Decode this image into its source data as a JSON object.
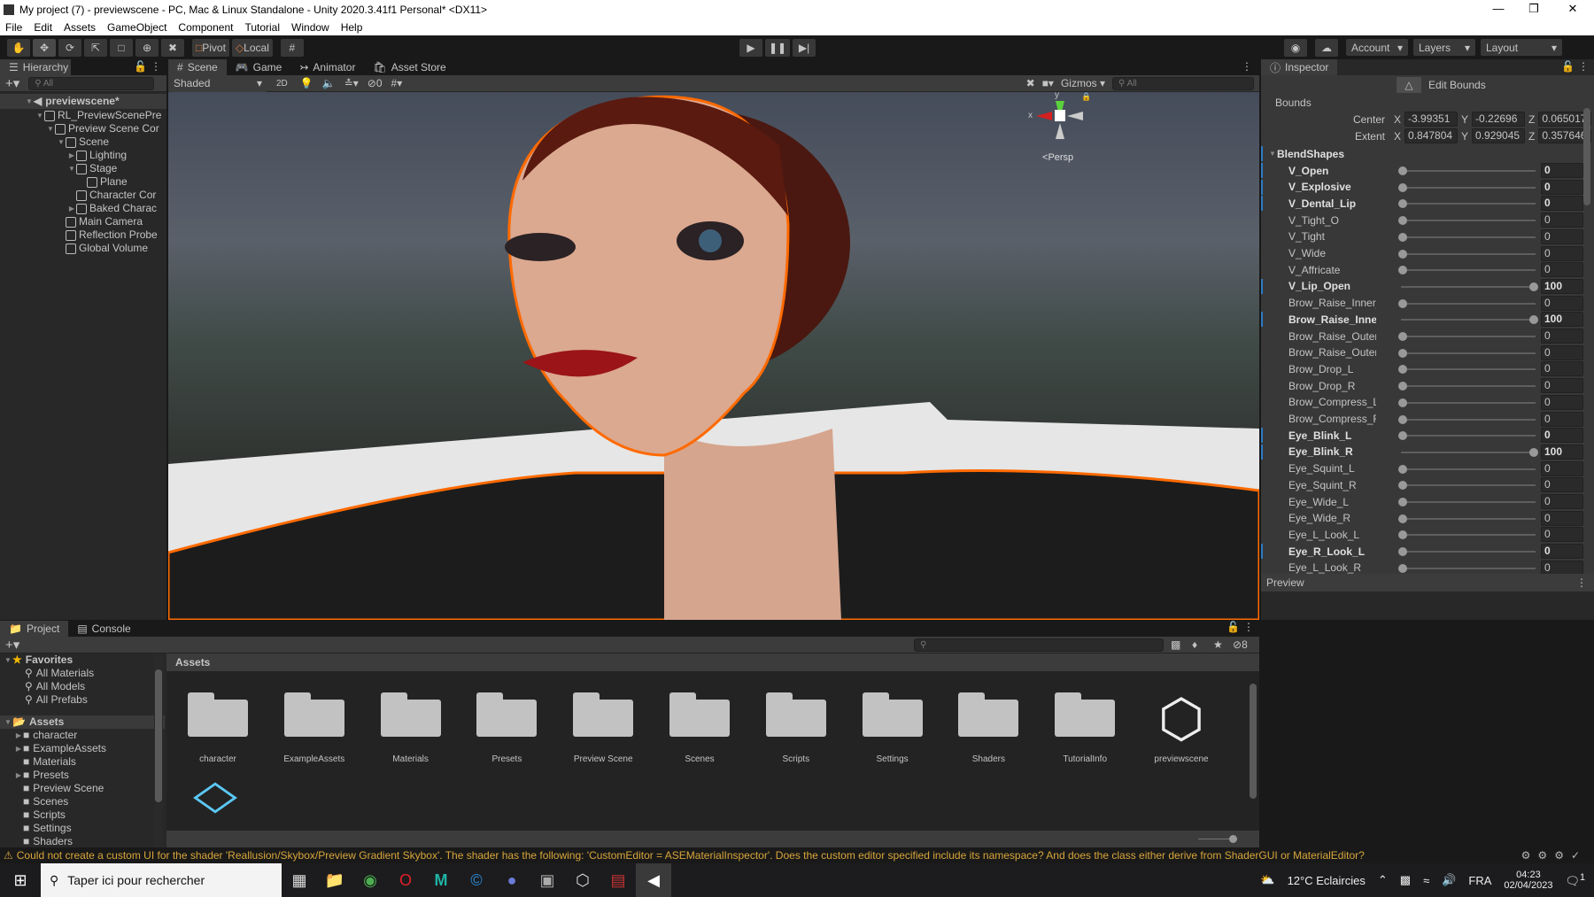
{
  "window": {
    "title": "My project (7) - previewscene - PC, Mac & Linux Standalone - Unity 2020.3.41f1 Personal* <DX11>"
  },
  "menu": [
    "File",
    "Edit",
    "Assets",
    "GameObject",
    "Component",
    "Tutorial",
    "Window",
    "Help"
  ],
  "toolbar": {
    "pivot": "Pivot",
    "local": "Local",
    "account": "Account",
    "layers": "Layers",
    "layout": "Layout"
  },
  "hierarchy": {
    "tab": "Hierarchy",
    "search_placeholder": "All",
    "items": [
      {
        "label": "previewscene*",
        "depth": 0,
        "arrow": "open",
        "scene": true
      },
      {
        "label": "RL_PreviewScenePre",
        "depth": 1,
        "arrow": "open"
      },
      {
        "label": "Preview Scene Cor",
        "depth": 2,
        "arrow": "open"
      },
      {
        "label": "Scene",
        "depth": 3,
        "arrow": "open"
      },
      {
        "label": "Lighting",
        "depth": 4,
        "arrow": "closed"
      },
      {
        "label": "Stage",
        "depth": 4,
        "arrow": "open"
      },
      {
        "label": "Plane",
        "depth": 5,
        "arrow": ""
      },
      {
        "label": "Character Cor",
        "depth": 4,
        "arrow": ""
      },
      {
        "label": "Baked Charac",
        "depth": 4,
        "arrow": "closed"
      },
      {
        "label": "Main Camera",
        "depth": 3,
        "arrow": ""
      },
      {
        "label": "Reflection Probe",
        "depth": 3,
        "arrow": ""
      },
      {
        "label": "Global Volume",
        "depth": 3,
        "arrow": ""
      }
    ]
  },
  "scene": {
    "tabs": [
      "Scene",
      "Game",
      "Animator",
      "Asset Store"
    ],
    "shading": "Shaded",
    "mode_2d": "2D",
    "hidden_count": "0",
    "gizmos": "Gizmos",
    "search_placeholder": "All",
    "gizmo": {
      "x": "x",
      "y": "y",
      "persp": "Persp"
    },
    "outline_color": "#ff6a00"
  },
  "inspector": {
    "tab": "Inspector",
    "edit_bounds": "Edit Bounds",
    "bounds_label": "Bounds",
    "center": {
      "label": "Center",
      "x": "-3.99351",
      "y": "-0.22696",
      "z": "0.065017"
    },
    "extent": {
      "label": "Extent",
      "x": "0.847804",
      "y": "0.929045",
      "z": "0.357646"
    },
    "blendshapes_label": "BlendShapes",
    "blendshapes": [
      {
        "name": "V_Open",
        "value": 0,
        "modified": true
      },
      {
        "name": "V_Explosive",
        "value": 0,
        "modified": true
      },
      {
        "name": "V_Dental_Lip",
        "value": 0,
        "modified": true
      },
      {
        "name": "V_Tight_O",
        "value": 0,
        "modified": false
      },
      {
        "name": "V_Tight",
        "value": 0,
        "modified": false
      },
      {
        "name": "V_Wide",
        "value": 0,
        "modified": false
      },
      {
        "name": "V_Affricate",
        "value": 0,
        "modified": false
      },
      {
        "name": "V_Lip_Open",
        "value": 100,
        "modified": true
      },
      {
        "name": "Brow_Raise_Inner_L",
        "value": 0,
        "modified": false
      },
      {
        "name": "Brow_Raise_Inner_R",
        "value": 100,
        "modified": true
      },
      {
        "name": "Brow_Raise_Outer_L",
        "value": 0,
        "modified": false
      },
      {
        "name": "Brow_Raise_Outer_R",
        "value": 0,
        "modified": false
      },
      {
        "name": "Brow_Drop_L",
        "value": 0,
        "modified": false
      },
      {
        "name": "Brow_Drop_R",
        "value": 0,
        "modified": false
      },
      {
        "name": "Brow_Compress_L",
        "value": 0,
        "modified": false
      },
      {
        "name": "Brow_Compress_R",
        "value": 0,
        "modified": false
      },
      {
        "name": "Eye_Blink_L",
        "value": 0,
        "modified": true
      },
      {
        "name": "Eye_Blink_R",
        "value": 100,
        "modified": true
      },
      {
        "name": "Eye_Squint_L",
        "value": 0,
        "modified": false
      },
      {
        "name": "Eye_Squint_R",
        "value": 0,
        "modified": false
      },
      {
        "name": "Eye_Wide_L",
        "value": 0,
        "modified": false
      },
      {
        "name": "Eye_Wide_R",
        "value": 0,
        "modified": false
      },
      {
        "name": "Eye_L_Look_L",
        "value": 0,
        "modified": false
      },
      {
        "name": "Eye_R_Look_L",
        "value": 0,
        "modified": true
      },
      {
        "name": "Eye_L_Look_R",
        "value": 0,
        "modified": false
      }
    ],
    "preview": "Preview"
  },
  "project": {
    "tabs": [
      "Project",
      "Console"
    ],
    "hidden_count": "8",
    "favorites_label": "Favorites",
    "favorites": [
      "All Materials",
      "All Models",
      "All Prefabs"
    ],
    "assets_label": "Assets",
    "tree": [
      {
        "label": "character",
        "arrow": true
      },
      {
        "label": "ExampleAssets",
        "arrow": true
      },
      {
        "label": "Materials",
        "arrow": false
      },
      {
        "label": "Presets",
        "arrow": true
      },
      {
        "label": "Preview Scene",
        "arrow": false
      },
      {
        "label": "Scenes",
        "arrow": false
      },
      {
        "label": "Scripts",
        "arrow": false
      },
      {
        "label": "Settings",
        "arrow": false
      },
      {
        "label": "Shaders",
        "arrow": false
      }
    ],
    "breadcrumb": "Assets",
    "grid": [
      {
        "label": "character",
        "type": "folder"
      },
      {
        "label": "ExampleAssets",
        "type": "folder"
      },
      {
        "label": "Materials",
        "type": "folder"
      },
      {
        "label": "Presets",
        "type": "folder"
      },
      {
        "label": "Preview Scene",
        "type": "folder"
      },
      {
        "label": "Scenes",
        "type": "folder"
      },
      {
        "label": "Scripts",
        "type": "folder"
      },
      {
        "label": "Settings",
        "type": "folder"
      },
      {
        "label": "Shaders",
        "type": "folder"
      },
      {
        "label": "TutorialInfo",
        "type": "folder"
      },
      {
        "label": "previewscene",
        "type": "scene"
      }
    ]
  },
  "status": {
    "message": "Could not create a custom UI for the shader 'Reallusion/Skybox/Preview Gradient Skybox'. The shader has the following: 'CustomEditor = ASEMaterialInspector'. Does the custom editor specified include its namespace? And does the class either derive from ShaderGUI or MaterialEditor?",
    "warning_color": "#d8a63b"
  },
  "taskbar": {
    "search_placeholder": "Taper ici pour rechercher",
    "weather": "12°C  Eclaircies",
    "language": "FRA",
    "time": "04:23",
    "date": "02/04/2023",
    "notifications": "1"
  }
}
